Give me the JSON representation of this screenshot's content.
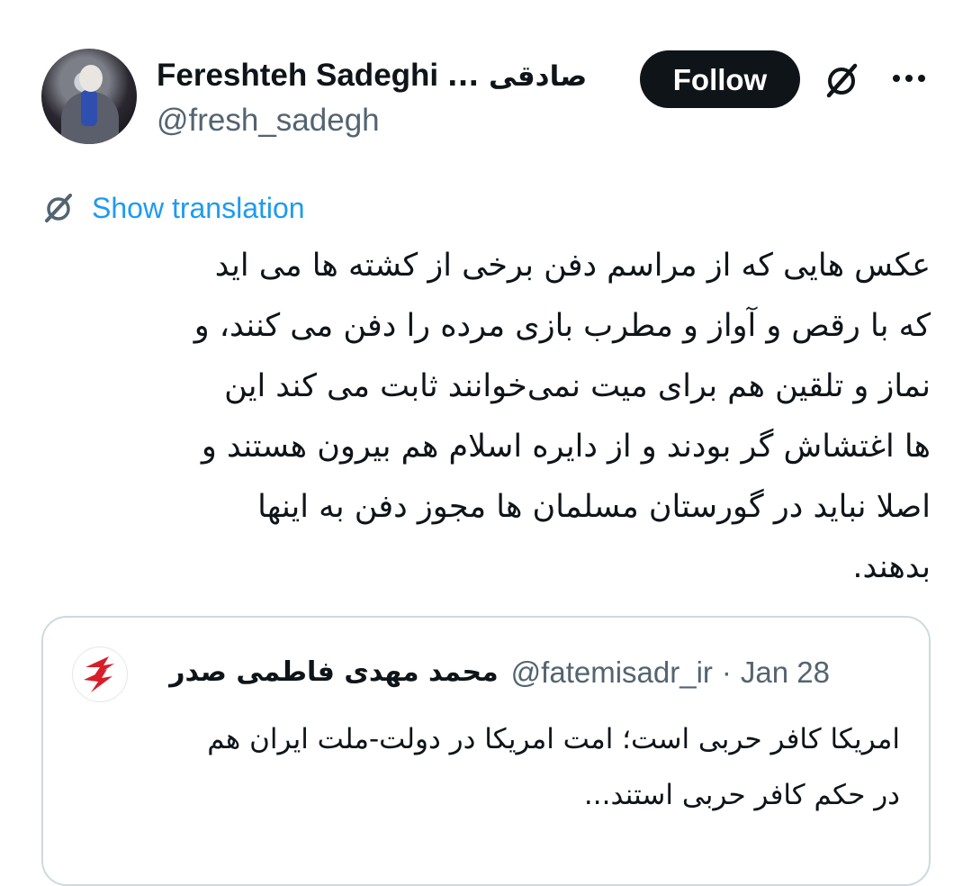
{
  "author": {
    "display_name": "Fereshteh Sadeghi",
    "display_name_rtl": "... صادقی",
    "handle": "@fresh_sadegh",
    "avatar_icon": "profile-photo-avatar"
  },
  "actions": {
    "follow_label": "Follow",
    "grok_icon": "grok-icon",
    "more_icon": "more-dots-icon"
  },
  "translation": {
    "icon": "translate-icon",
    "label": "Show translation"
  },
  "tweet": {
    "text": "عکس هایی که از مراسم دفن برخی از کشته ها می اید\nکه با رقص و آواز و مطرب بازی مرده را دفن می کنند،  و\nنماز و تلقین هم برای میت نمی‌خوانند ثابت می کند این\nها اغتشاش گر بودند و از دایره اسلام هم بیرون هستند و\nاصلا نباید در گورستان مسلمان ها مجوز دفن به اینها\nبدهند."
  },
  "quote": {
    "name": "محمد مهدی فاطمی صدر",
    "handle": "@fatemisadr_ir",
    "separator": "·",
    "date": "Jan 28",
    "text": "امریکا کافر حربی است؛ امت امریکا در دولت-ملت ایران هم\nدر حکم کافر حربی استند...",
    "avatar_icon": "tasnim-logo-avatar"
  },
  "colors": {
    "text": "#0f1419",
    "secondary": "#536471",
    "link": "#1d9bf0",
    "border": "#cfd9de",
    "button": "#0f1419"
  }
}
